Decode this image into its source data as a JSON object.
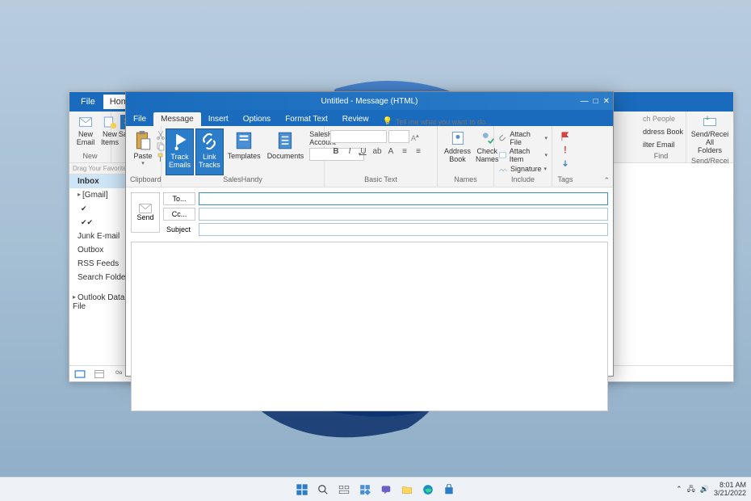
{
  "taskbar": {
    "time": "8:01 AM",
    "date": "3/21/2022"
  },
  "mainWindow": {
    "tabs": {
      "file": "File",
      "home": "Home"
    },
    "ribbon": {
      "newEmail": "New Email",
      "newItems": "New Items",
      "sales": "Sales",
      "newGroup": "New",
      "addressBook": "ddress Book",
      "filterEmail": "ilter Email",
      "findGroup": "Find",
      "sendReceive": "Send/Recei",
      "allFolders": "All Folders",
      "sendReceiveGroup": "Send/Recei",
      "searchPeople": "ch People"
    },
    "dragHint": "Drag Your Favorite F",
    "folders": {
      "inbox": "Inbox",
      "gmail": "[Gmail]",
      "junk": "Junk E-mail",
      "outbox": "Outbox",
      "rss": "RSS Feeds",
      "search": "Search Folders",
      "dataFile": "Outlook Data File"
    }
  },
  "compose": {
    "title": "Untitled - Message (HTML)",
    "tabs": {
      "file": "File",
      "message": "Message",
      "insert": "Insert",
      "options": "Options",
      "format": "Format Text",
      "review": "Review"
    },
    "tellMe": "Tell me what you want to do...",
    "ribbon": {
      "paste": "Paste",
      "clipboardGroup": "Clipboard",
      "trackEmails": "Track Emails",
      "linkTracks": "Link Tracks",
      "templates": "Templates",
      "documents": "Documents",
      "salesHandyAccount": "SalesHandy Account",
      "salesHandyGroup": "SalesHandy",
      "basicTextGroup": "Basic Text",
      "addressBook": "Address Book",
      "checkNames": "Check Names",
      "namesGroup": "Names",
      "attachFile": "Attach File",
      "attachItem": "Attach Item",
      "signature": "Signature",
      "includeGroup": "Include",
      "tagsGroup": "Tags"
    },
    "send": "Send",
    "fields": {
      "to": "To...",
      "cc": "Cc...",
      "subject": "Subject"
    }
  }
}
